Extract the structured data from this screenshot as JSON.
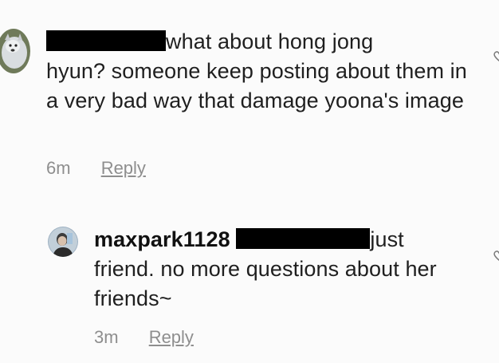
{
  "comments": [
    {
      "username_redacted": true,
      "text_line1": "what about hong jong",
      "text_rest": "hyun? someone keep posting about them in a very bad way that damage yoona's image",
      "time": "6m",
      "reply_label": "Reply",
      "avatar_icon": "dog-avatar",
      "like_icon": "heart-outline-icon"
    },
    {
      "username": "maxpark1128",
      "mention_redacted": true,
      "text_line1": "just",
      "text_rest": "friend. no more questions about her friends~",
      "time": "3m",
      "reply_label": "Reply",
      "avatar_icon": "person-avatar",
      "like_icon": "heart-outline-icon"
    }
  ]
}
